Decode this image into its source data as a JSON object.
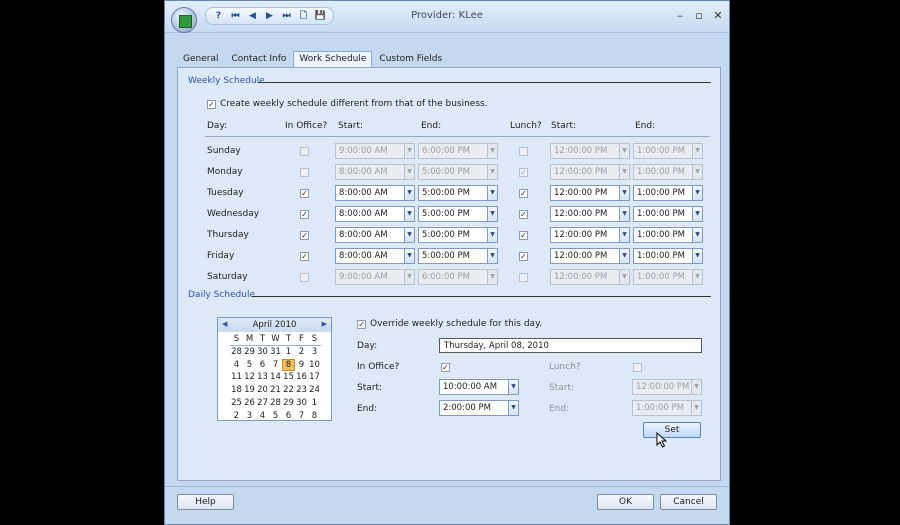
{
  "window": {
    "title": "Provider: KLee",
    "controls": {
      "minimize": "–",
      "maximize": "▫",
      "close": "✕"
    }
  },
  "toolbar": [
    {
      "name": "help-icon",
      "glyph": "?"
    },
    {
      "name": "first-record-icon",
      "glyph": "⏮"
    },
    {
      "name": "previous-record-icon",
      "glyph": "◀"
    },
    {
      "name": "next-record-icon",
      "glyph": "▶"
    },
    {
      "name": "last-record-icon",
      "glyph": "⏭"
    },
    {
      "name": "new-document-icon",
      "glyph": "🗋"
    },
    {
      "name": "save-icon",
      "glyph": "💾"
    }
  ],
  "tabs": [
    "General",
    "Contact Info",
    "Work Schedule",
    "Custom Fields"
  ],
  "active_tab": "Work Schedule",
  "weekly": {
    "section_title": "Weekly Schedule",
    "override_label": "Create weekly schedule different from that of the business.",
    "override_checked": true,
    "headers": {
      "day": "Day:",
      "in_office": "In Office?",
      "start": "Start:",
      "end": "End:",
      "lunch": "Lunch?",
      "lunch_start": "Start:",
      "lunch_end": "End:"
    },
    "rows": [
      {
        "day": "Sunday",
        "in_office": false,
        "start": "9:00:00 AM",
        "end": "6:00:00 PM",
        "lunch": false,
        "lunch_start": "12:00:00 PM",
        "lunch_end": "1:00:00 PM"
      },
      {
        "day": "Monday",
        "in_office": false,
        "start": "8:00:00 AM",
        "end": "5:00:00 PM",
        "lunch": true,
        "lunch_start": "12:00:00 PM",
        "lunch_end": "1:00:00 PM"
      },
      {
        "day": "Tuesday",
        "in_office": true,
        "start": "8:00:00 AM",
        "end": "5:00:00 PM",
        "lunch": true,
        "lunch_start": "12:00:00 PM",
        "lunch_end": "1:00:00 PM"
      },
      {
        "day": "Wednesday",
        "in_office": true,
        "start": "8:00:00 AM",
        "end": "5:00:00 PM",
        "lunch": true,
        "lunch_start": "12:00:00 PM",
        "lunch_end": "1:00:00 PM"
      },
      {
        "day": "Thursday",
        "in_office": true,
        "start": "8:00:00 AM",
        "end": "5:00:00 PM",
        "lunch": true,
        "lunch_start": "12:00:00 PM",
        "lunch_end": "1:00:00 PM"
      },
      {
        "day": "Friday",
        "in_office": true,
        "start": "8:00:00 AM",
        "end": "5:00:00 PM",
        "lunch": true,
        "lunch_start": "12:00:00 PM",
        "lunch_end": "1:00:00 PM"
      },
      {
        "day": "Saturday",
        "in_office": false,
        "start": "9:00:00 AM",
        "end": "6:00:00 PM",
        "lunch": false,
        "lunch_start": "12:00:00 PM",
        "lunch_end": "1:00:00 PM"
      }
    ]
  },
  "daily": {
    "section_title": "Daily Schedule",
    "override_label": "Override weekly schedule for this day.",
    "override_checked": true,
    "day_label": "Day:",
    "day_value": "Thursday, April 08, 2010",
    "in_office_label": "In Office?",
    "in_office_checked": true,
    "lunch_label": "Lunch?",
    "lunch_checked": false,
    "start_label": "Start:",
    "start_value": "10:00:00 AM",
    "end_label": "End:",
    "end_value": "2:00:00 PM",
    "lunch_start_label": "Start:",
    "lunch_start_value": "12:00:00 PM",
    "lunch_end_label": "End:",
    "lunch_end_value": "1:00:00 PM",
    "set_label": "Set"
  },
  "calendar": {
    "title": "April 2010",
    "prev": "◀",
    "next": "▶",
    "weekdays": [
      "S",
      "M",
      "T",
      "W",
      "T",
      "F",
      "S"
    ],
    "days": [
      "28",
      "29",
      "30",
      "31",
      "1",
      "2",
      "3",
      "4",
      "5",
      "6",
      "7",
      "8",
      "9",
      "10",
      "11",
      "12",
      "13",
      "14",
      "15",
      "16",
      "17",
      "18",
      "19",
      "20",
      "21",
      "22",
      "23",
      "24",
      "25",
      "26",
      "27",
      "28",
      "29",
      "30",
      "1",
      "2",
      "3",
      "4",
      "5",
      "6",
      "7",
      "8"
    ],
    "selected_index": 11
  },
  "footer": {
    "help": "Help",
    "ok": "OK",
    "cancel": "Cancel"
  },
  "colors": {
    "accent": "#2c55b0",
    "window_bg": "#c4d8ef",
    "panel_bg": "#dde9f6",
    "selected_day": "#f5c15a"
  }
}
